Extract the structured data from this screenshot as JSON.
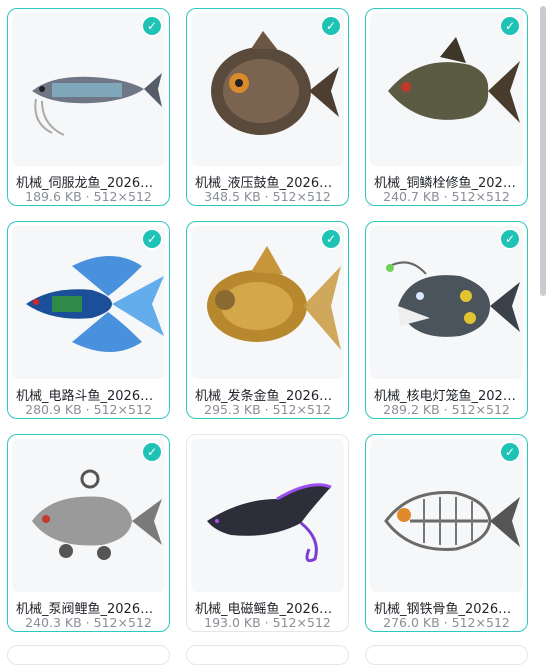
{
  "cards": [
    {
      "name": "机械_伺服龙鱼_202605...",
      "size": "189.6 KB",
      "dims": "512×512",
      "selected": true,
      "icon": "arowana-fish-image"
    },
    {
      "name": "机械_液压鼓鱼_202605...",
      "size": "348.5 KB",
      "dims": "512×512",
      "selected": true,
      "icon": "pufferfish-image"
    },
    {
      "name": "机械_铜鳞栓修鱼_2026...",
      "size": "240.7 KB",
      "dims": "512×512",
      "selected": true,
      "icon": "bronze-scale-fish-image"
    },
    {
      "name": "机械_电路斗鱼_202605...",
      "size": "280.9 KB",
      "dims": "512×512",
      "selected": true,
      "icon": "betta-fish-image"
    },
    {
      "name": "机械_发条金鱼_202605...",
      "size": "295.3 KB",
      "dims": "512×512",
      "selected": true,
      "icon": "goldfish-image"
    },
    {
      "name": "机械_核电灯笼鱼_2026...",
      "size": "289.2 KB",
      "dims": "512×512",
      "selected": true,
      "icon": "anglerfish-image"
    },
    {
      "name": "机械_泵阀鲤鱼_202605...",
      "size": "240.3 KB",
      "dims": "512×512",
      "selected": true,
      "icon": "carp-image"
    },
    {
      "name": "机械_电磁鳐鱼_202605...",
      "size": "193.0 KB",
      "dims": "512×512",
      "selected": false,
      "icon": "ray-fish-image"
    },
    {
      "name": "机械_钢铁骨鱼_202605...",
      "size": "276.0 KB",
      "dims": "512×512",
      "selected": true,
      "icon": "skeleton-fish-image"
    }
  ],
  "separator": "·",
  "check_glyph": "✓",
  "colors": {
    "accent": "#1fc3b5",
    "border_selected": "#2ec9bd"
  }
}
